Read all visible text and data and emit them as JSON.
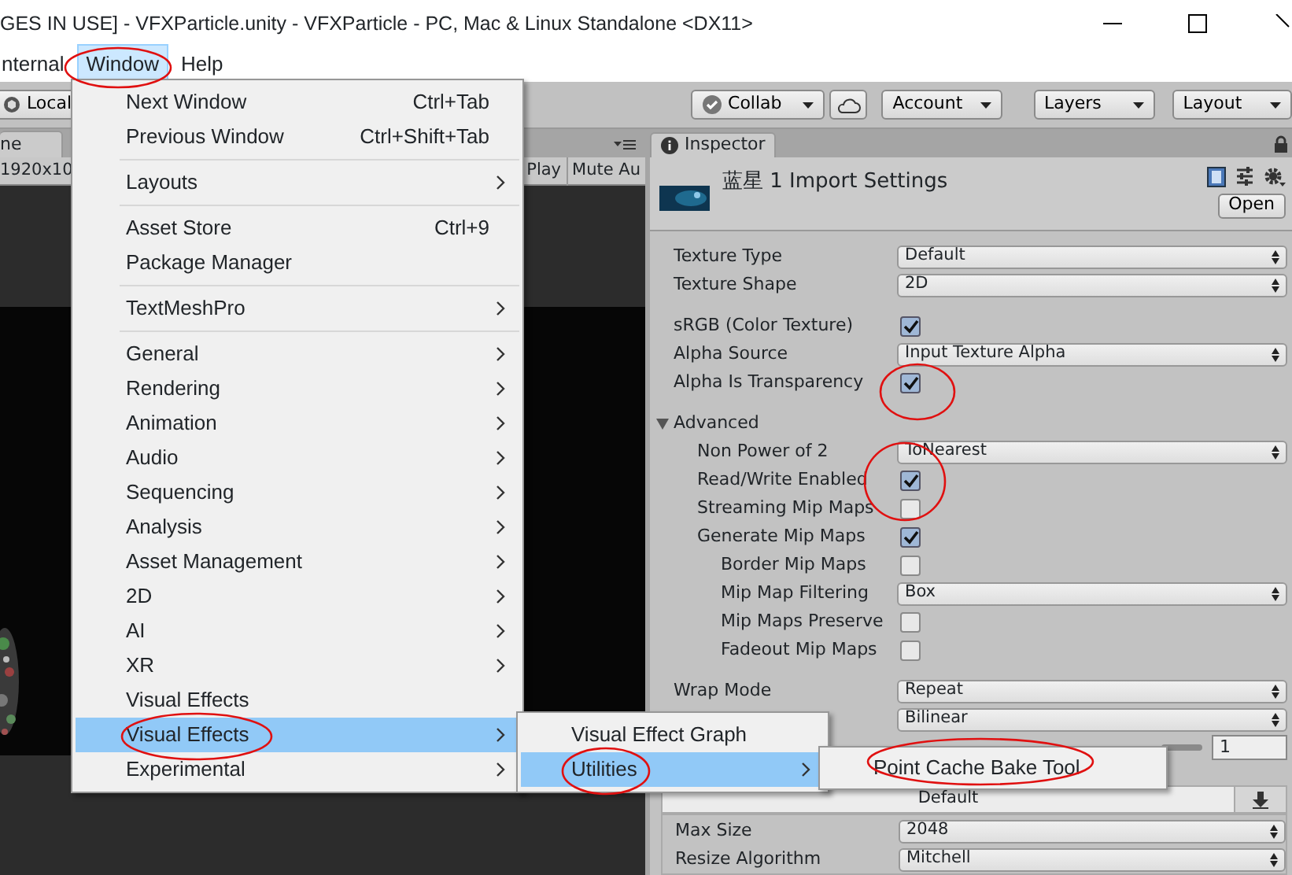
{
  "window": {
    "title": "GES IN USE] - VFXParticle.unity - VFXParticle - PC, Mac & Linux Standalone <DX11>"
  },
  "menu_bar": [
    {
      "label": "nternal",
      "selected": false
    },
    {
      "label": "Window",
      "selected": true
    },
    {
      "label": "Help",
      "selected": false
    }
  ],
  "toolbar": {
    "local_button": "Local",
    "collab_button": "Collab",
    "account_button": "Account",
    "layers_button": "Layers",
    "layout_button": "Layout"
  },
  "game_view": {
    "tab": "ne",
    "resolution": "1920x10",
    "buttons": [
      "Play",
      "Mute Au"
    ]
  },
  "inspector": {
    "tab": "Inspector",
    "title": "蓝星 1 Import Settings",
    "open_button": "Open",
    "sections": [
      [
        {
          "kind": "dropdown",
          "label": "Texture Type",
          "value": "Default"
        },
        {
          "kind": "dropdown",
          "label": "Texture Shape",
          "value": "2D"
        }
      ],
      [
        {
          "kind": "checkbox",
          "label": "sRGB (Color Texture)",
          "checked": true
        },
        {
          "kind": "dropdown",
          "label": "Alpha Source",
          "value": "Input Texture Alpha"
        },
        {
          "kind": "checkbox",
          "label": "Alpha Is Transparency",
          "checked": true
        },
        {
          "kind": "foldout",
          "label": "Advanced",
          "expanded": true,
          "children": [
            {
              "kind": "dropdown",
              "label": "Non Power of 2",
              "value": "ToNearest"
            },
            {
              "kind": "checkbox",
              "label": "Read/Write Enabled",
              "checked": true
            },
            {
              "kind": "checkbox",
              "label": "Streaming Mip Maps",
              "checked": false
            },
            {
              "kind": "checkbox",
              "label": "Generate Mip Maps",
              "checked": true,
              "children": [
                {
                  "kind": "checkbox",
                  "label": "Border Mip Maps",
                  "checked": false
                },
                {
                  "kind": "dropdown",
                  "label": "Mip Map Filtering",
                  "value": "Box"
                },
                {
                  "kind": "checkbox",
                  "label": "Mip Maps Preserve",
                  "checked": false
                },
                {
                  "kind": "checkbox",
                  "label": "Fadeout Mip Maps",
                  "checked": false
                }
              ]
            }
          ]
        }
      ],
      [
        {
          "kind": "dropdown",
          "label": "Wrap Mode",
          "value": "Repeat"
        },
        {
          "kind": "dropdown",
          "value": "Bilinear"
        },
        {
          "kind": "number",
          "value": "1"
        }
      ]
    ],
    "platform_tab": "Default",
    "platform_rows": [
      {
        "kind": "dropdown",
        "label": "Max Size",
        "value": "2048"
      },
      {
        "kind": "dropdown",
        "label": "Resize Algorithm",
        "value": "Mitchell"
      }
    ]
  },
  "window_menu": {
    "groups": [
      [
        {
          "label": "Next Window",
          "shortcut": "Ctrl+Tab",
          "submenu": false,
          "selected": false
        },
        {
          "label": "Previous Window",
          "shortcut": "Ctrl+Shift+Tab",
          "submenu": false,
          "selected": false
        }
      ],
      [
        {
          "label": "Layouts",
          "submenu": true,
          "selected": false
        }
      ],
      [
        {
          "label": "Asset Store",
          "shortcut": "Ctrl+9",
          "submenu": false,
          "selected": false
        },
        {
          "label": "Package Manager",
          "submenu": false,
          "selected": false
        }
      ],
      [
        {
          "label": "TextMeshPro",
          "submenu": true,
          "selected": false
        }
      ],
      [
        {
          "label": "General",
          "submenu": true,
          "selected": false
        },
        {
          "label": "Rendering",
          "submenu": true,
          "selected": false
        },
        {
          "label": "Animation",
          "submenu": true,
          "selected": false
        },
        {
          "label": "Audio",
          "submenu": true,
          "selected": false
        },
        {
          "label": "Sequencing",
          "submenu": true,
          "selected": false
        },
        {
          "label": "Analysis",
          "submenu": true,
          "selected": false
        },
        {
          "label": "Asset Management",
          "submenu": true,
          "selected": false
        },
        {
          "label": "2D",
          "submenu": true,
          "selected": false
        },
        {
          "label": "AI",
          "submenu": true,
          "selected": false
        },
        {
          "label": "XR",
          "submenu": true,
          "selected": false
        },
        {
          "label": "Visual Effects",
          "submenu": false,
          "selected": false
        },
        {
          "label": "Visual Effects",
          "submenu": true,
          "selected": true
        },
        {
          "label": "Experimental",
          "submenu": true,
          "selected": false
        }
      ]
    ]
  },
  "submenus": [
    {
      "items": [
        {
          "label": "Visual Effect Graph",
          "submenu": false,
          "selected": false
        },
        {
          "label": "Utilities",
          "submenu": true,
          "selected": true
        }
      ]
    },
    {
      "items": [
        {
          "label": "Point Cache Bake Tool",
          "submenu": false,
          "selected": false
        }
      ]
    }
  ]
}
